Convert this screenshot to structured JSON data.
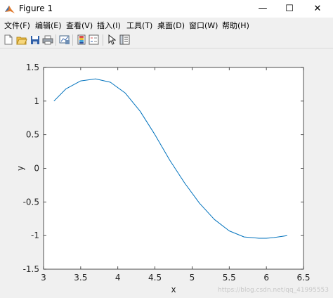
{
  "window": {
    "title": "Figure 1",
    "minimize": "—",
    "maximize": "☐",
    "close": "✕"
  },
  "menu": [
    "文件(F)",
    "编辑(E)",
    "查看(V)",
    "插入(I)",
    "工具(T)",
    "桌面(D)",
    "窗口(W)",
    "帮助(H)"
  ],
  "toolbar_icons": [
    "new-figure-icon",
    "open-file-icon",
    "save-icon",
    "print-icon",
    "link-plot-icon",
    "colorbar-icon",
    "legend-icon",
    "pointer-icon",
    "property-inspector-icon"
  ],
  "chart_data": {
    "type": "line",
    "title": "",
    "xlabel": "x",
    "ylabel": "y",
    "xlim": [
      3,
      6.5
    ],
    "ylim": [
      -1.5,
      1.5
    ],
    "xticks": [
      "3",
      "3.5",
      "4",
      "4.5",
      "5",
      "5.5",
      "6",
      "6.5"
    ],
    "yticks": [
      "-1.5",
      "-1",
      "-0.5",
      "0",
      "0.5",
      "1",
      "1.5"
    ],
    "grid": false,
    "series": [
      {
        "color": "#0072bd",
        "x": [
          3.14,
          3.3,
          3.5,
          3.7,
          3.9,
          4.1,
          4.3,
          4.5,
          4.7,
          4.9,
          5.1,
          5.3,
          5.5,
          5.7,
          5.9,
          6.0,
          6.1,
          6.28
        ],
        "y": [
          1.0,
          1.18,
          1.3,
          1.33,
          1.28,
          1.12,
          0.85,
          0.5,
          0.12,
          -0.22,
          -0.52,
          -0.76,
          -0.93,
          -1.02,
          -1.04,
          -1.04,
          -1.03,
          -1.0
        ]
      }
    ]
  },
  "watermark": "https://blog.csdn.net/qq_41995553"
}
